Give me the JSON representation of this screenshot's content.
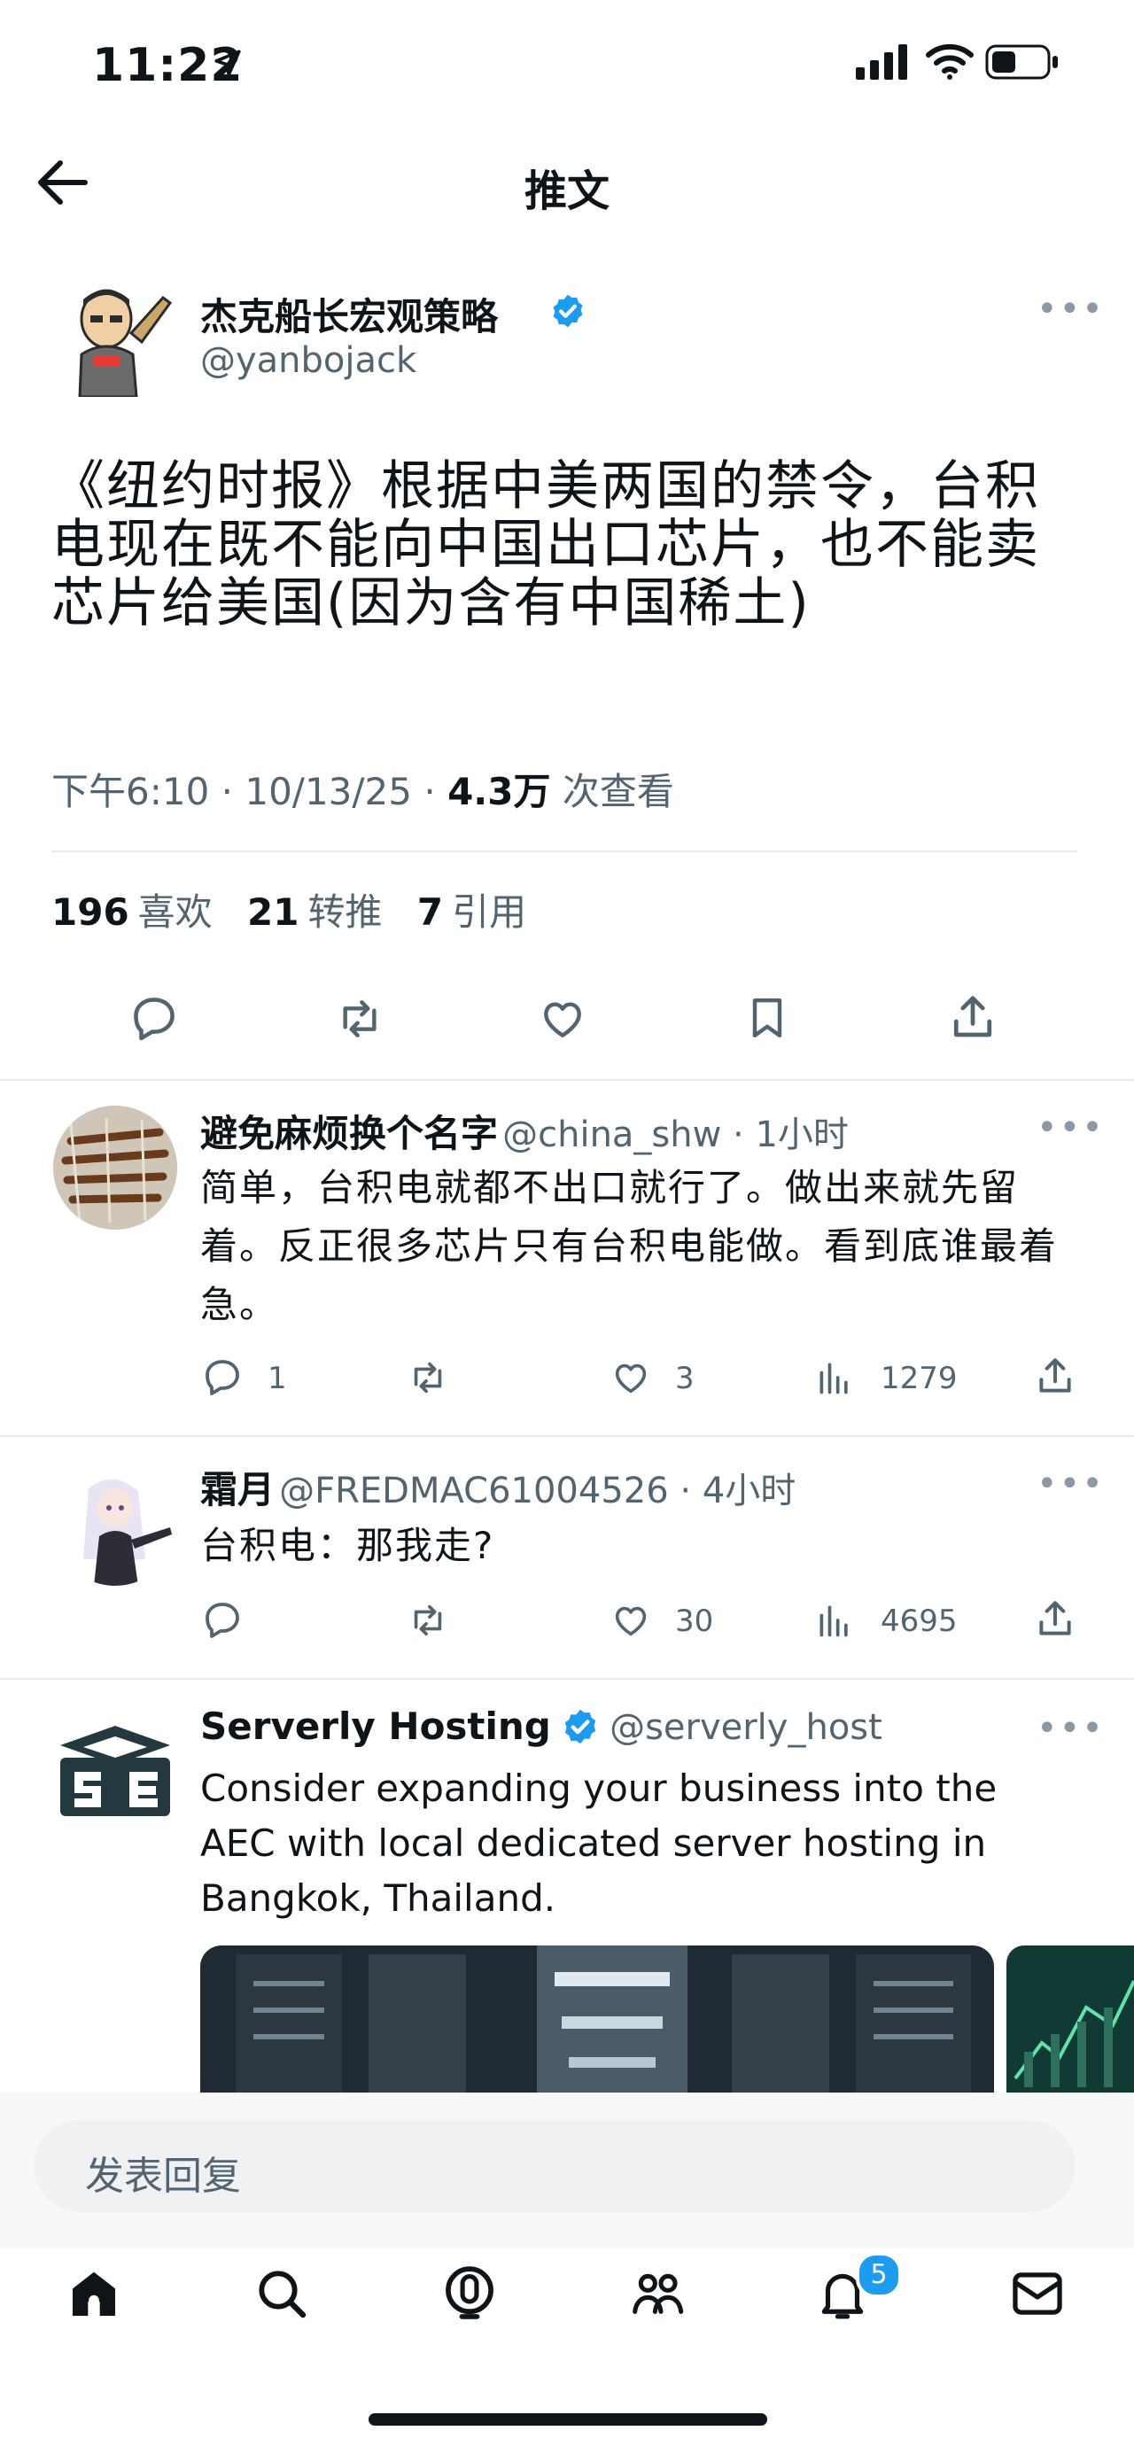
{
  "status_bar": {
    "time": "11:22"
  },
  "header": {
    "title": "推文"
  },
  "main_tweet": {
    "author_name": "杰克船长宏观策略",
    "author_handle": "@yanbojack",
    "text": "《纽约时报》根据中美两国的禁令，台积电现在既不能向中国出口芯片，也不能卖芯片给美国(因为含有中国稀土)",
    "time": "下午6:10 · 10/13/25 · ",
    "views_count": "4.3万",
    "views_label": " 次查看",
    "likes_count": "196",
    "likes_label": "喜欢",
    "retweets_count": "21",
    "retweets_label": "转推",
    "quotes_count": "7",
    "quotes_label": "引用"
  },
  "replies": [
    {
      "name": "避免麻烦换个名字",
      "handle_time": "@china_shw · 1小时",
      "text": "简单，台积电就都不出口就行了。做出来就先留着。反正很多芯片只有台积电能做。看到底谁最着急。",
      "reply_count": "1",
      "like_count": "3",
      "view_count": "1279"
    },
    {
      "name": "霜月",
      "handle_time": "@FREDMAC61004526 · 4小时",
      "text": "台积电：那我走?",
      "reply_count": "",
      "like_count": "30",
      "view_count": "4695"
    }
  ],
  "ad": {
    "name": "Serverly Hosting",
    "handle": "@serverly_host",
    "text": "Consider expanding your business into the AEC with local dedicated server hosting in Bangkok, Thailand."
  },
  "reply_input": {
    "placeholder": "发表回复"
  },
  "tabbar": {
    "notifications_badge": "5"
  },
  "colors": {
    "accent": "#1d9bf0",
    "text": "#0f1419",
    "secondary": "#536471"
  },
  "icons": [
    "location-arrow-icon",
    "signal-icon",
    "wifi-icon",
    "battery-icon",
    "back-arrow-icon",
    "verified-badge-icon",
    "more-icon",
    "reply-icon",
    "retweet-icon",
    "like-icon",
    "bookmark-icon",
    "share-icon",
    "views-icon",
    "home-icon",
    "search-icon",
    "spaces-icon",
    "communities-icon",
    "notifications-icon",
    "messages-icon"
  ]
}
